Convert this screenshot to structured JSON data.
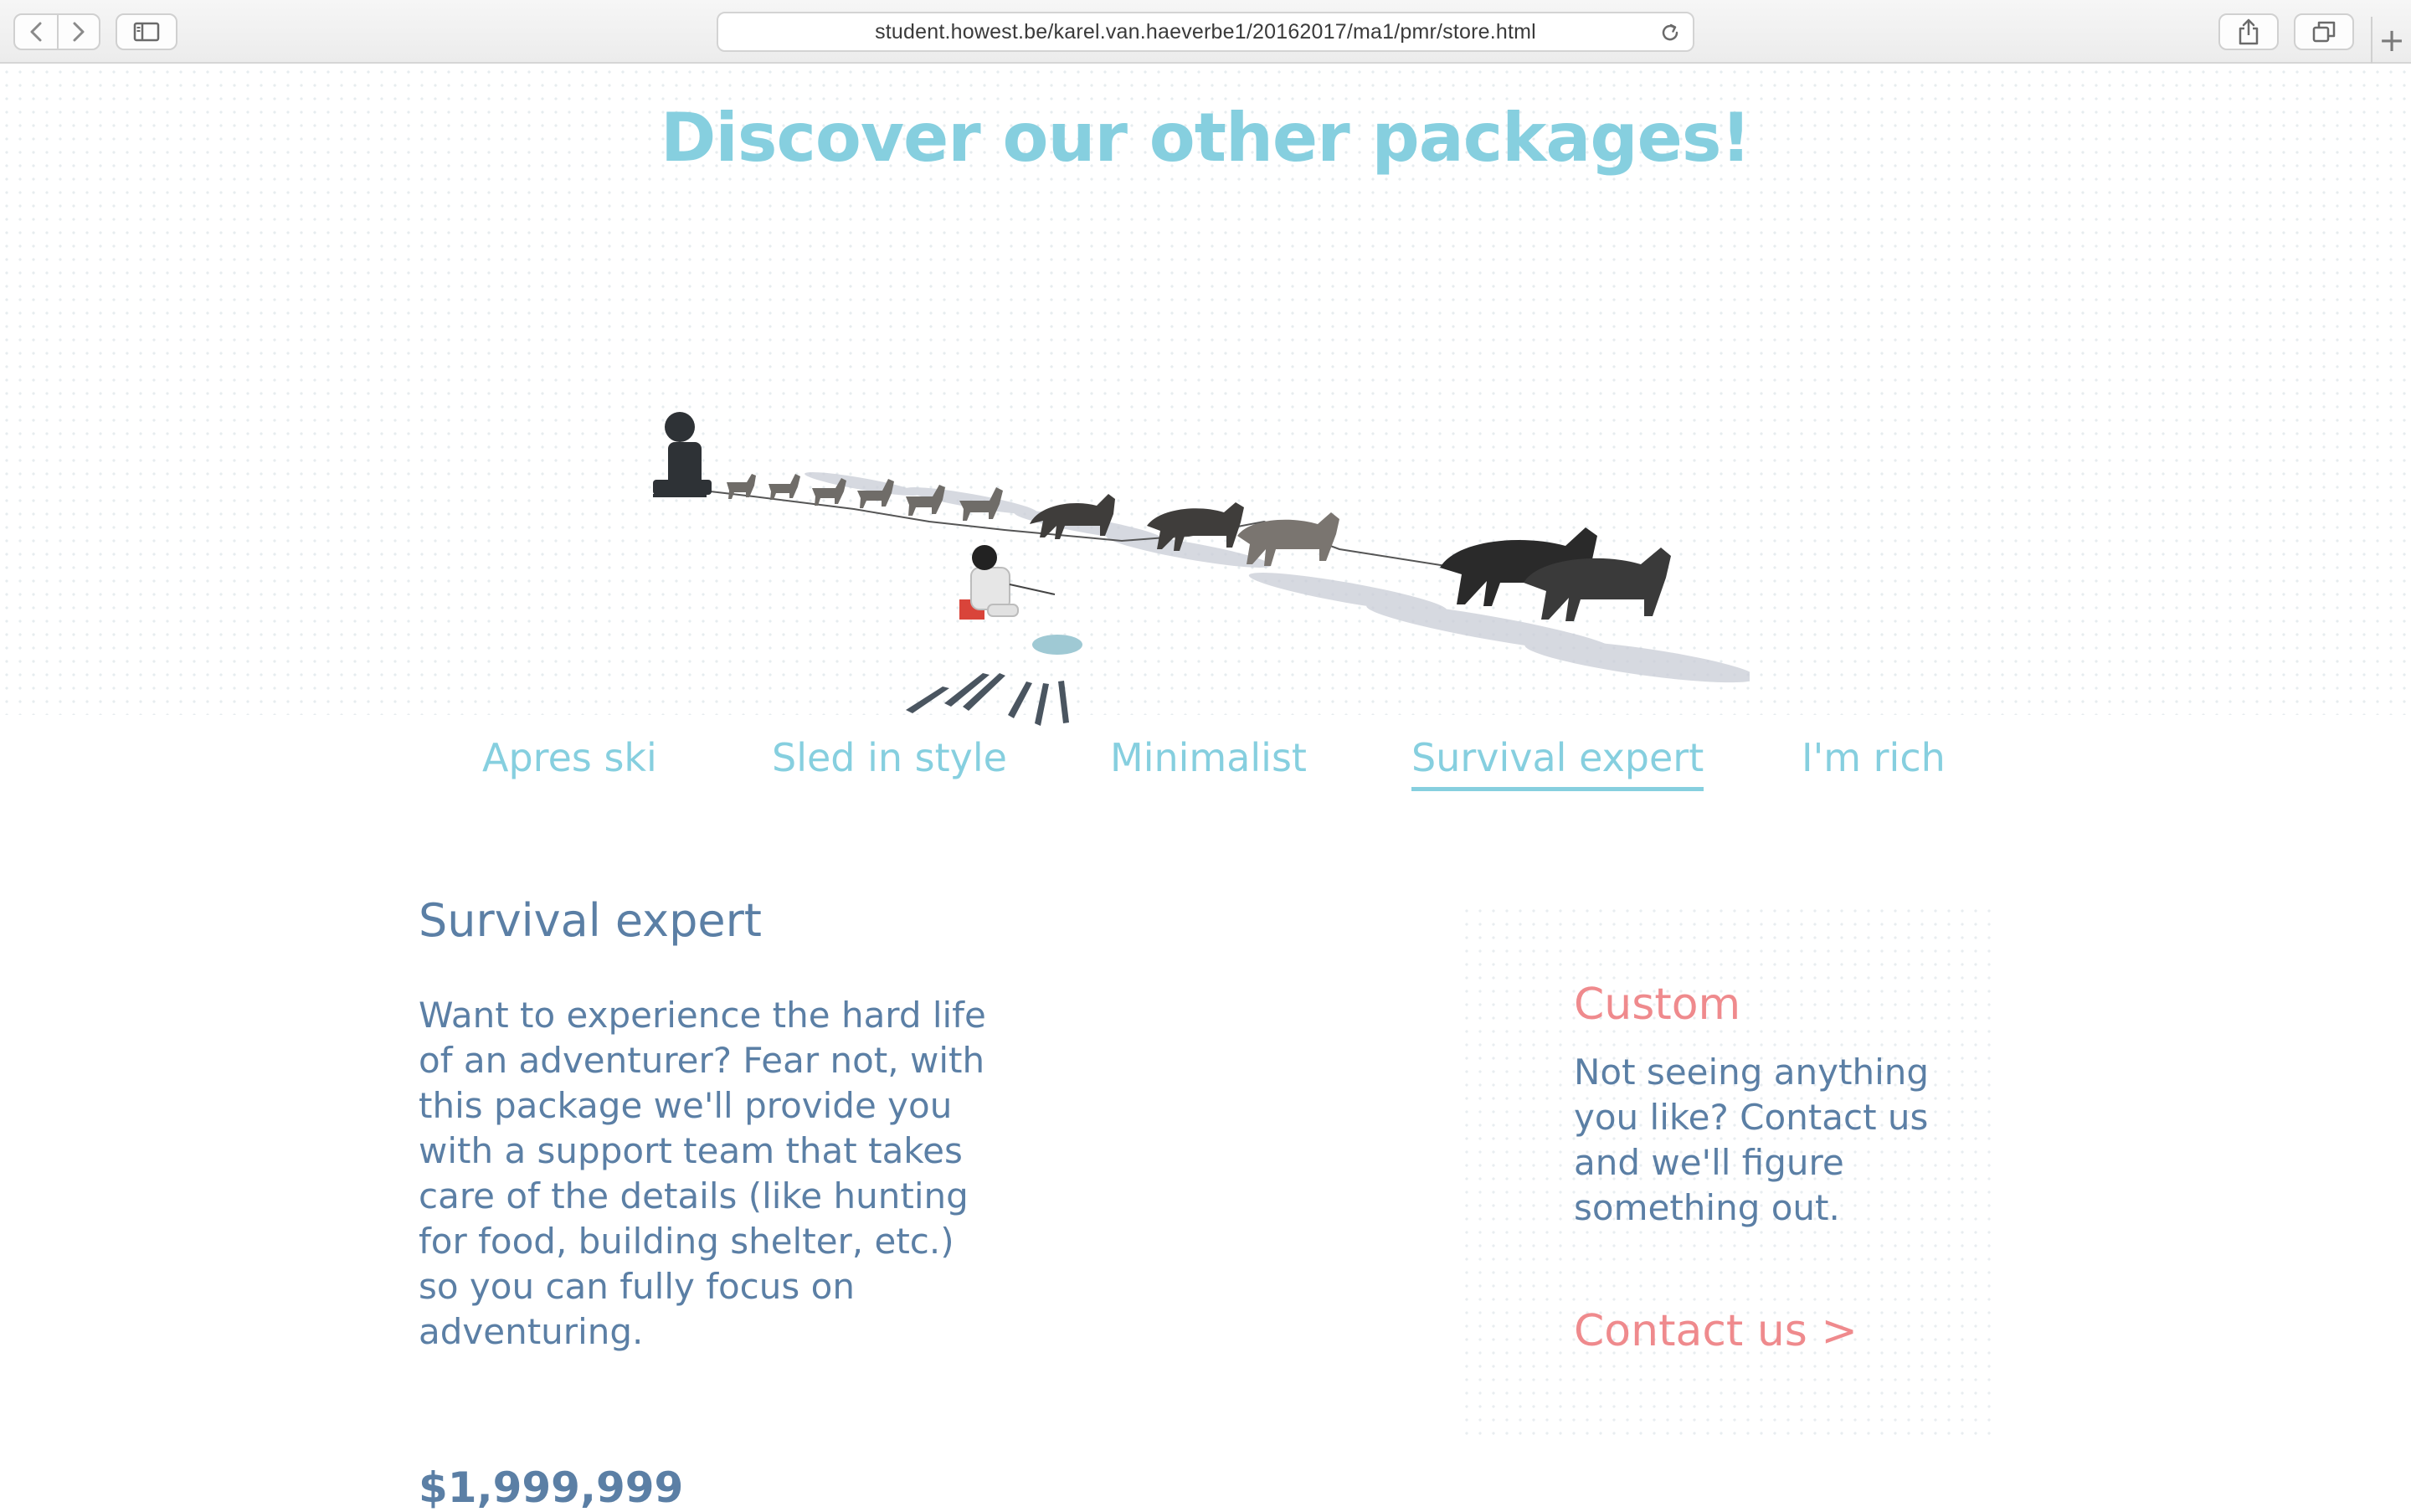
{
  "browser": {
    "url": "student.howest.be/karel.van.haeverbe1/20162017/ma1/pmr/store.html",
    "new_tab_glyph": "+",
    "icons": [
      "back-arrow-icon",
      "forward-arrow-icon",
      "sidebar-icon",
      "reload-icon",
      "share-icon",
      "tabs-icon",
      "plus-icon"
    ]
  },
  "hero": {
    "title": "Discover our other packages!"
  },
  "packages": {
    "tabs": [
      {
        "label": "Apres ski",
        "active": false
      },
      {
        "label": "Sled in style",
        "active": false
      },
      {
        "label": "Minimalist",
        "active": false
      },
      {
        "label": "Survival expert",
        "active": true
      },
      {
        "label": "I'm rich",
        "active": false
      }
    ],
    "selected": {
      "title": "Survival expert",
      "description": "Want to experience the hard life of an adventurer? Fear not, with this package we'll provide you with a support team that takes care of the details (like hunting for food, building shelter, etc.) so you can fully focus on adventuring.",
      "price": "$1,999,999"
    }
  },
  "custom": {
    "title": "Custom",
    "text": "Not seeing anything you like? Contact us and we'll figure something out.",
    "link_label": "Contact us >"
  },
  "colors": {
    "accent_blue": "#86cfdf",
    "text_blue": "#5b7fa5",
    "accent_pink": "#ef8a8d"
  }
}
